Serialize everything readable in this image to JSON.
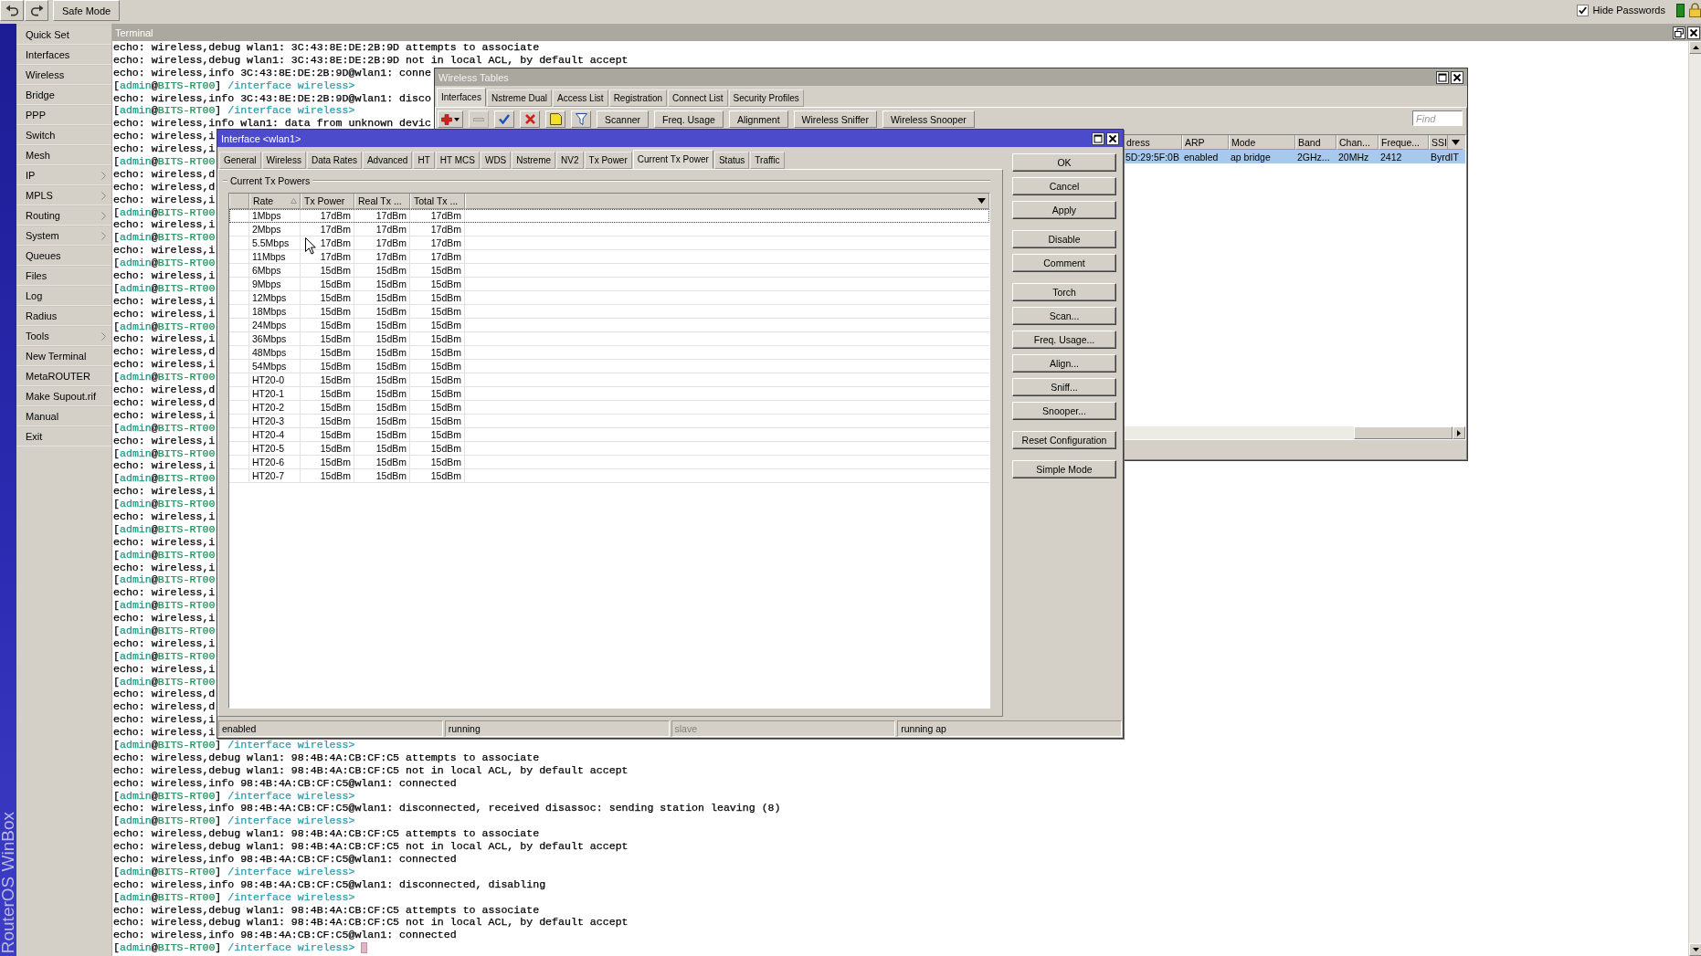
{
  "toolbar": {
    "safe_mode": {
      "label": "Safe Mode"
    },
    "hide_passwords": {
      "label": "Hide Passwords",
      "checked": true
    }
  },
  "sidebar": {
    "brand": "RouterOS WinBox",
    "items": [
      {
        "label": "Quick Set",
        "has_submenu": false
      },
      {
        "label": "Interfaces",
        "has_submenu": false
      },
      {
        "label": "Wireless",
        "has_submenu": false
      },
      {
        "label": "Bridge",
        "has_submenu": false
      },
      {
        "label": "PPP",
        "has_submenu": false
      },
      {
        "label": "Switch",
        "has_submenu": false
      },
      {
        "label": "Mesh",
        "has_submenu": false
      },
      {
        "label": "IP",
        "has_submenu": true
      },
      {
        "label": "MPLS",
        "has_submenu": true
      },
      {
        "label": "Routing",
        "has_submenu": true
      },
      {
        "label": "System",
        "has_submenu": true
      },
      {
        "label": "Queues",
        "has_submenu": false
      },
      {
        "label": "Files",
        "has_submenu": false
      },
      {
        "label": "Log",
        "has_submenu": false
      },
      {
        "label": "Radius",
        "has_submenu": false
      },
      {
        "label": "Tools",
        "has_submenu": true
      },
      {
        "label": "New Terminal",
        "has_submenu": false
      },
      {
        "label": "MetaROUTER",
        "has_submenu": false
      },
      {
        "label": "Make Supout.rif",
        "has_submenu": false
      },
      {
        "label": "Manual",
        "has_submenu": false
      },
      {
        "label": "Exit",
        "has_submenu": false
      }
    ]
  },
  "terminal": {
    "title": "Terminal",
    "cursor": true,
    "lines": [
      {
        "kind": "echo",
        "text": "echo: wireless,debug wlan1: 3C:43:8E:DE:2B:9D attempts to associate"
      },
      {
        "kind": "echo",
        "text": "echo: wireless,debug wlan1: 3C:43:8E:DE:2B:9D not in local ACL, by default accept"
      },
      {
        "kind": "echo",
        "text": "echo: wireless,info 3C:43:8E:DE:2B:9D@wlan1: conne"
      },
      {
        "kind": "prompt",
        "parts": [
          "[",
          "admin",
          "@",
          "BITS-RT00",
          "]",
          " /interface wireless>"
        ]
      },
      {
        "kind": "echo",
        "text": "echo: wireless,info 3C:43:8E:DE:2B:9D@wlan1: disco"
      },
      {
        "kind": "prompt",
        "parts": [
          "[",
          "admin",
          "@",
          "BITS-RT00",
          "]",
          " /interface wireless>"
        ]
      },
      {
        "kind": "echo",
        "text": "echo: wireless,info wlan1: data from unknown devic"
      },
      {
        "kind": "echo",
        "text": "echo: wireless,i"
      },
      {
        "kind": "echo",
        "text": "echo: wireless,i"
      },
      {
        "kind": "prompt",
        "parts": [
          "[",
          "admin",
          "@",
          "BITS-RT00"
        ]
      },
      {
        "kind": "echo",
        "text": "echo: wireless,d"
      },
      {
        "kind": "echo",
        "text": "echo: wireless,d"
      },
      {
        "kind": "echo",
        "text": "echo: wireless,i"
      },
      {
        "kind": "prompt",
        "parts": [
          "[",
          "admin",
          "@",
          "BITS-RT00"
        ]
      },
      {
        "kind": "echo",
        "text": "echo: wireless,i"
      },
      {
        "kind": "prompt",
        "parts": [
          "[",
          "admin",
          "@",
          "BITS-RT00"
        ]
      },
      {
        "kind": "echo",
        "text": "echo: wireless,i"
      },
      {
        "kind": "prompt",
        "parts": [
          "[",
          "admin",
          "@",
          "BITS-RT00"
        ]
      },
      {
        "kind": "echo",
        "text": "echo: wireless,i"
      },
      {
        "kind": "prompt",
        "parts": [
          "[",
          "admin",
          "@",
          "BITS-RT00"
        ]
      },
      {
        "kind": "echo",
        "text": "echo: wireless,i"
      },
      {
        "kind": "echo",
        "text": "echo: wireless,i"
      },
      {
        "kind": "prompt",
        "parts": [
          "[",
          "admin",
          "@",
          "BITS-RT00"
        ]
      },
      {
        "kind": "echo",
        "text": "echo: wireless,i"
      },
      {
        "kind": "echo",
        "text": "echo: wireless,d"
      },
      {
        "kind": "echo",
        "text": "echo: wireless,i"
      },
      {
        "kind": "prompt",
        "parts": [
          "[",
          "admin",
          "@",
          "BITS-RT00"
        ]
      },
      {
        "kind": "echo",
        "text": "echo: wireless,d"
      },
      {
        "kind": "echo",
        "text": "echo: wireless,d"
      },
      {
        "kind": "echo",
        "text": "echo: wireless,i"
      },
      {
        "kind": "prompt",
        "parts": [
          "[",
          "admin",
          "@",
          "BITS-RT00"
        ]
      },
      {
        "kind": "echo",
        "text": "echo: wireless,i"
      },
      {
        "kind": "prompt",
        "parts": [
          "[",
          "admin",
          "@",
          "BITS-RT00"
        ]
      },
      {
        "kind": "echo",
        "text": "echo: wireless,i"
      },
      {
        "kind": "prompt",
        "parts": [
          "[",
          "admin",
          "@",
          "BITS-RT00"
        ]
      },
      {
        "kind": "echo",
        "text": "echo: wireless,i"
      },
      {
        "kind": "prompt",
        "parts": [
          "[",
          "admin",
          "@",
          "BITS-RT00"
        ]
      },
      {
        "kind": "echo",
        "text": "echo: wireless,i"
      },
      {
        "kind": "prompt",
        "parts": [
          "[",
          "admin",
          "@",
          "BITS-RT00"
        ]
      },
      {
        "kind": "echo",
        "text": "echo: wireless,i"
      },
      {
        "kind": "prompt",
        "parts": [
          "[",
          "admin",
          "@",
          "BITS-RT00"
        ]
      },
      {
        "kind": "echo",
        "text": "echo: wireless,i"
      },
      {
        "kind": "prompt",
        "parts": [
          "[",
          "admin",
          "@",
          "BITS-RT00"
        ]
      },
      {
        "kind": "echo",
        "text": "echo: wireless,i"
      },
      {
        "kind": "prompt",
        "parts": [
          "[",
          "admin",
          "@",
          "BITS-RT00"
        ]
      },
      {
        "kind": "echo",
        "text": "echo: wireless,i"
      },
      {
        "kind": "prompt",
        "parts": [
          "[",
          "admin",
          "@",
          "BITS-RT00"
        ]
      },
      {
        "kind": "echo",
        "text": "echo: wireless,i"
      },
      {
        "kind": "prompt",
        "parts": [
          "[",
          "admin",
          "@",
          "BITS-RT00"
        ]
      },
      {
        "kind": "echo",
        "text": "echo: wireless,i"
      },
      {
        "kind": "prompt",
        "parts": [
          "[",
          "admin",
          "@",
          "BITS-RT00"
        ]
      },
      {
        "kind": "echo",
        "text": "echo: wireless,d"
      },
      {
        "kind": "echo",
        "text": "echo: wireless,d"
      },
      {
        "kind": "echo",
        "text": "echo: wireless,i"
      },
      {
        "kind": "echo",
        "text": "echo: wireless,i"
      },
      {
        "kind": "prompt",
        "parts": [
          "[",
          "admin",
          "@",
          "BITS-RT00",
          "]",
          " /interface wireless>"
        ]
      },
      {
        "kind": "echo",
        "text": "echo: wireless,debug wlan1: 98:4B:4A:CB:CF:C5 attempts to associate"
      },
      {
        "kind": "echo",
        "text": "echo: wireless,debug wlan1: 98:4B:4A:CB:CF:C5 not in local ACL, by default accept"
      },
      {
        "kind": "echo",
        "text": "echo: wireless,info 98:4B:4A:CB:CF:C5@wlan1: connected"
      },
      {
        "kind": "prompt",
        "parts": [
          "[",
          "admin",
          "@",
          "BITS-RT00",
          "]",
          " /interface wireless>"
        ]
      },
      {
        "kind": "echo",
        "text": "echo: wireless,info 98:4B:4A:CB:CF:C5@wlan1: disconnected, received disassoc: sending station leaving (8)"
      },
      {
        "kind": "prompt",
        "parts": [
          "[",
          "admin",
          "@",
          "BITS-RT00",
          "]",
          " /interface wireless>"
        ]
      },
      {
        "kind": "echo",
        "text": "echo: wireless,debug wlan1: 98:4B:4A:CB:CF:C5 attempts to associate"
      },
      {
        "kind": "echo",
        "text": "echo: wireless,debug wlan1: 98:4B:4A:CB:CF:C5 not in local ACL, by default accept"
      },
      {
        "kind": "echo",
        "text": "echo: wireless,info 98:4B:4A:CB:CF:C5@wlan1: connected"
      },
      {
        "kind": "prompt",
        "parts": [
          "[",
          "admin",
          "@",
          "BITS-RT00",
          "]",
          " /interface wireless>"
        ]
      },
      {
        "kind": "echo",
        "text": "echo: wireless,info 98:4B:4A:CB:CF:C5@wlan1: disconnected, disabling"
      },
      {
        "kind": "prompt",
        "parts": [
          "[",
          "admin",
          "@",
          "BITS-RT00",
          "]",
          " /interface wireless>"
        ]
      },
      {
        "kind": "echo",
        "text": "echo: wireless,debug wlan1: 98:4B:4A:CB:CF:C5 attempts to associate"
      },
      {
        "kind": "echo",
        "text": "echo: wireless,debug wlan1: 98:4B:4A:CB:CF:C5 not in local ACL, by default accept"
      },
      {
        "kind": "echo",
        "text": "echo: wireless,info 98:4B:4A:CB:CF:C5@wlan1: connected"
      },
      {
        "kind": "prompt",
        "parts": [
          "[",
          "admin",
          "@",
          "BITS-RT00",
          "]",
          " /interface wireless>"
        ]
      }
    ]
  },
  "wireless_tables": {
    "title": "Wireless Tables",
    "tabs": [
      {
        "label": "Interfaces",
        "selected": true
      },
      {
        "label": "Nstreme Dual",
        "selected": false
      },
      {
        "label": "Access List",
        "selected": false
      },
      {
        "label": "Registration",
        "selected": false
      },
      {
        "label": "Connect List",
        "selected": false
      },
      {
        "label": "Security Profiles",
        "selected": false
      }
    ],
    "icon_buttons": [
      {
        "kind": "add",
        "disabled": false
      },
      {
        "kind": "remove",
        "disabled": true
      },
      {
        "kind": "enable",
        "disabled": false
      },
      {
        "kind": "disable",
        "disabled": false
      },
      {
        "kind": "comment",
        "disabled": false
      },
      {
        "kind": "filter",
        "disabled": false
      }
    ],
    "toolbar_buttons": [
      "Scanner",
      "Freq. Usage",
      "Alignment",
      "Wireless Sniffer",
      "Wireless Snooper"
    ],
    "find": {
      "placeholder": "Find"
    },
    "table": {
      "columns": [
        "dress",
        "ARP",
        "Mode",
        "Band",
        "Chan...",
        "Freque...",
        "SSI"
      ],
      "rows": [
        {
          "selected": true,
          "cells": [
            "5D:29:5F:0B",
            "enabled",
            "ap bridge",
            "2GHz...",
            "20MHz",
            "2412",
            "ByrdIT"
          ]
        }
      ]
    }
  },
  "interface_dialog": {
    "title": "Interface <wlan1>",
    "tabs": [
      {
        "label": "General",
        "selected": false
      },
      {
        "label": "Wireless",
        "selected": false
      },
      {
        "label": "Data Rates",
        "selected": false
      },
      {
        "label": "Advanced",
        "selected": false
      },
      {
        "label": "HT",
        "selected": false
      },
      {
        "label": "HT MCS",
        "selected": false
      },
      {
        "label": "WDS",
        "selected": false
      },
      {
        "label": "Nstreme",
        "selected": false
      },
      {
        "label": "NV2",
        "selected": false
      },
      {
        "label": "Tx Power",
        "selected": false
      },
      {
        "label": "Current Tx Power",
        "selected": true
      },
      {
        "label": "Status",
        "selected": false
      },
      {
        "label": "Traffic",
        "selected": false
      }
    ],
    "group_title": "Current Tx Powers",
    "table": {
      "columns": [
        {
          "label": "Rate",
          "sorted": true
        },
        {
          "label": "Tx Power",
          "sorted": false
        },
        {
          "label": "Real Tx ...",
          "sorted": false
        },
        {
          "label": "Total Tx ...",
          "sorted": false
        }
      ],
      "rows": [
        {
          "focused": true,
          "cells": [
            "1Mbps",
            "17dBm",
            "17dBm",
            "17dBm"
          ]
        },
        {
          "focused": false,
          "cells": [
            "2Mbps",
            "17dBm",
            "17dBm",
            "17dBm"
          ]
        },
        {
          "focused": false,
          "cells": [
            "5.5Mbps",
            "17dBm",
            "17dBm",
            "17dBm"
          ]
        },
        {
          "focused": false,
          "cells": [
            "11Mbps",
            "17dBm",
            "17dBm",
            "17dBm"
          ]
        },
        {
          "focused": false,
          "cells": [
            "6Mbps",
            "15dBm",
            "15dBm",
            "15dBm"
          ]
        },
        {
          "focused": false,
          "cells": [
            "9Mbps",
            "15dBm",
            "15dBm",
            "15dBm"
          ]
        },
        {
          "focused": false,
          "cells": [
            "12Mbps",
            "15dBm",
            "15dBm",
            "15dBm"
          ]
        },
        {
          "focused": false,
          "cells": [
            "18Mbps",
            "15dBm",
            "15dBm",
            "15dBm"
          ]
        },
        {
          "focused": false,
          "cells": [
            "24Mbps",
            "15dBm",
            "15dBm",
            "15dBm"
          ]
        },
        {
          "focused": false,
          "cells": [
            "36Mbps",
            "15dBm",
            "15dBm",
            "15dBm"
          ]
        },
        {
          "focused": false,
          "cells": [
            "48Mbps",
            "15dBm",
            "15dBm",
            "15dBm"
          ]
        },
        {
          "focused": false,
          "cells": [
            "54Mbps",
            "15dBm",
            "15dBm",
            "15dBm"
          ]
        },
        {
          "focused": false,
          "cells": [
            "HT20-0",
            "15dBm",
            "15dBm",
            "15dBm"
          ]
        },
        {
          "focused": false,
          "cells": [
            "HT20-1",
            "15dBm",
            "15dBm",
            "15dBm"
          ]
        },
        {
          "focused": false,
          "cells": [
            "HT20-2",
            "15dBm",
            "15dBm",
            "15dBm"
          ]
        },
        {
          "focused": false,
          "cells": [
            "HT20-3",
            "15dBm",
            "15dBm",
            "15dBm"
          ]
        },
        {
          "focused": false,
          "cells": [
            "HT20-4",
            "15dBm",
            "15dBm",
            "15dBm"
          ]
        },
        {
          "focused": false,
          "cells": [
            "HT20-5",
            "15dBm",
            "15dBm",
            "15dBm"
          ]
        },
        {
          "focused": false,
          "cells": [
            "HT20-6",
            "15dBm",
            "15dBm",
            "15dBm"
          ]
        },
        {
          "focused": false,
          "cells": [
            "HT20-7",
            "15dBm",
            "15dBm",
            "15dBm"
          ]
        }
      ]
    },
    "button_groups": [
      [
        "OK",
        "Cancel",
        "Apply"
      ],
      [
        "Disable",
        "Comment"
      ],
      [
        "Torch",
        "Scan...",
        "Freq. Usage...",
        "Align...",
        "Sniff...",
        "Snooper..."
      ],
      [
        "Reset Configuration"
      ],
      [
        "Simple Mode"
      ]
    ],
    "status": [
      {
        "text": "enabled",
        "disabled": false
      },
      {
        "text": "running",
        "disabled": false
      },
      {
        "text": "slave",
        "disabled": true
      },
      {
        "text": "running ap",
        "disabled": false
      }
    ]
  }
}
